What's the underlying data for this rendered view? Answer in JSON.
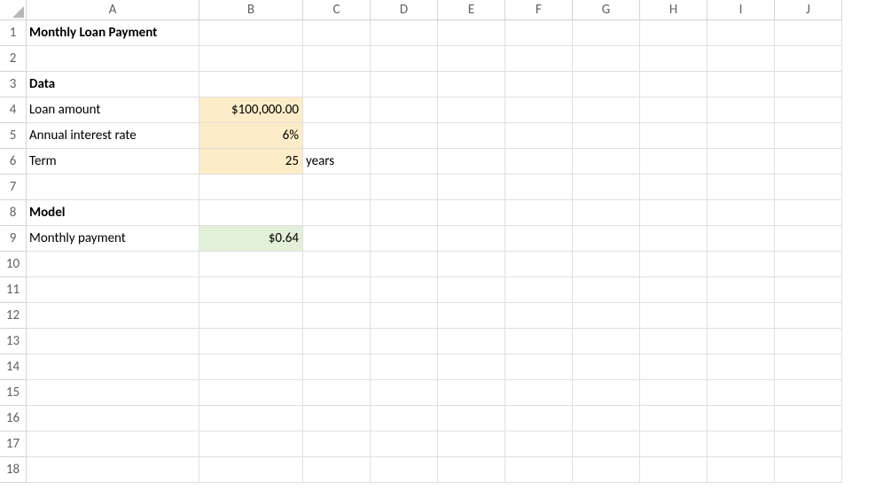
{
  "columns": [
    "A",
    "B",
    "C",
    "D",
    "E",
    "F",
    "G",
    "H",
    "I",
    "J"
  ],
  "rows": [
    "1",
    "2",
    "3",
    "4",
    "5",
    "6",
    "7",
    "8",
    "9",
    "10",
    "11",
    "12",
    "13",
    "14",
    "15",
    "16",
    "17",
    "18"
  ],
  "cells": {
    "A1": "Monthly Loan Payment",
    "A3": "Data",
    "A4": "Loan amount",
    "B4": "$100,000.00",
    "A5": "Annual interest rate",
    "B5": "6%",
    "A6": "Term",
    "B6": "25",
    "C6": "years",
    "A8": "Model",
    "A9": "Monthly payment",
    "B9": "$0.64"
  }
}
